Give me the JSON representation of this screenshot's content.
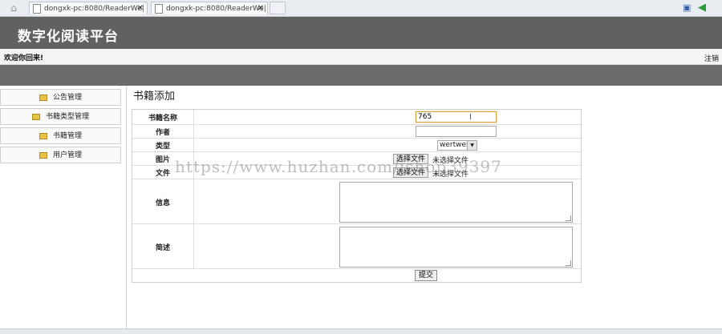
{
  "browser": {
    "tabs": [
      {
        "label": "dongxk-pc:8080/ReaderWe|"
      },
      {
        "label": "dongxk-pc:8080/ReaderWe|"
      }
    ],
    "close_glyph": "✕"
  },
  "header": {
    "site_title": "数字化阅读平台",
    "welcome": "欢迎你回来!",
    "logout": "注销"
  },
  "sidebar": {
    "items": [
      {
        "label": "公告管理"
      },
      {
        "label": "书籍类型管理"
      },
      {
        "label": "书籍管理"
      },
      {
        "label": "用户管理"
      }
    ]
  },
  "main": {
    "page_title": "书籍添加",
    "form": {
      "name_label": "书籍名称",
      "name_value": "765",
      "author_label": "作者",
      "author_value": "",
      "type_label": "类型",
      "type_selected": "wertwert",
      "image_label": "图片",
      "image_button": "选择文件",
      "image_status": "未选择文件",
      "file_label": "文件",
      "file_button": "选择文件",
      "file_status": "未选择文件",
      "info_label": "信息",
      "desc_label": "简述",
      "submit_label": "提交"
    }
  },
  "watermark": "https://www.huzhan.com/ishop39397",
  "icons": {
    "home": "home-icon",
    "doc": "page-icon",
    "folder": "folder-icon",
    "back": "back-arrow-icon"
  }
}
